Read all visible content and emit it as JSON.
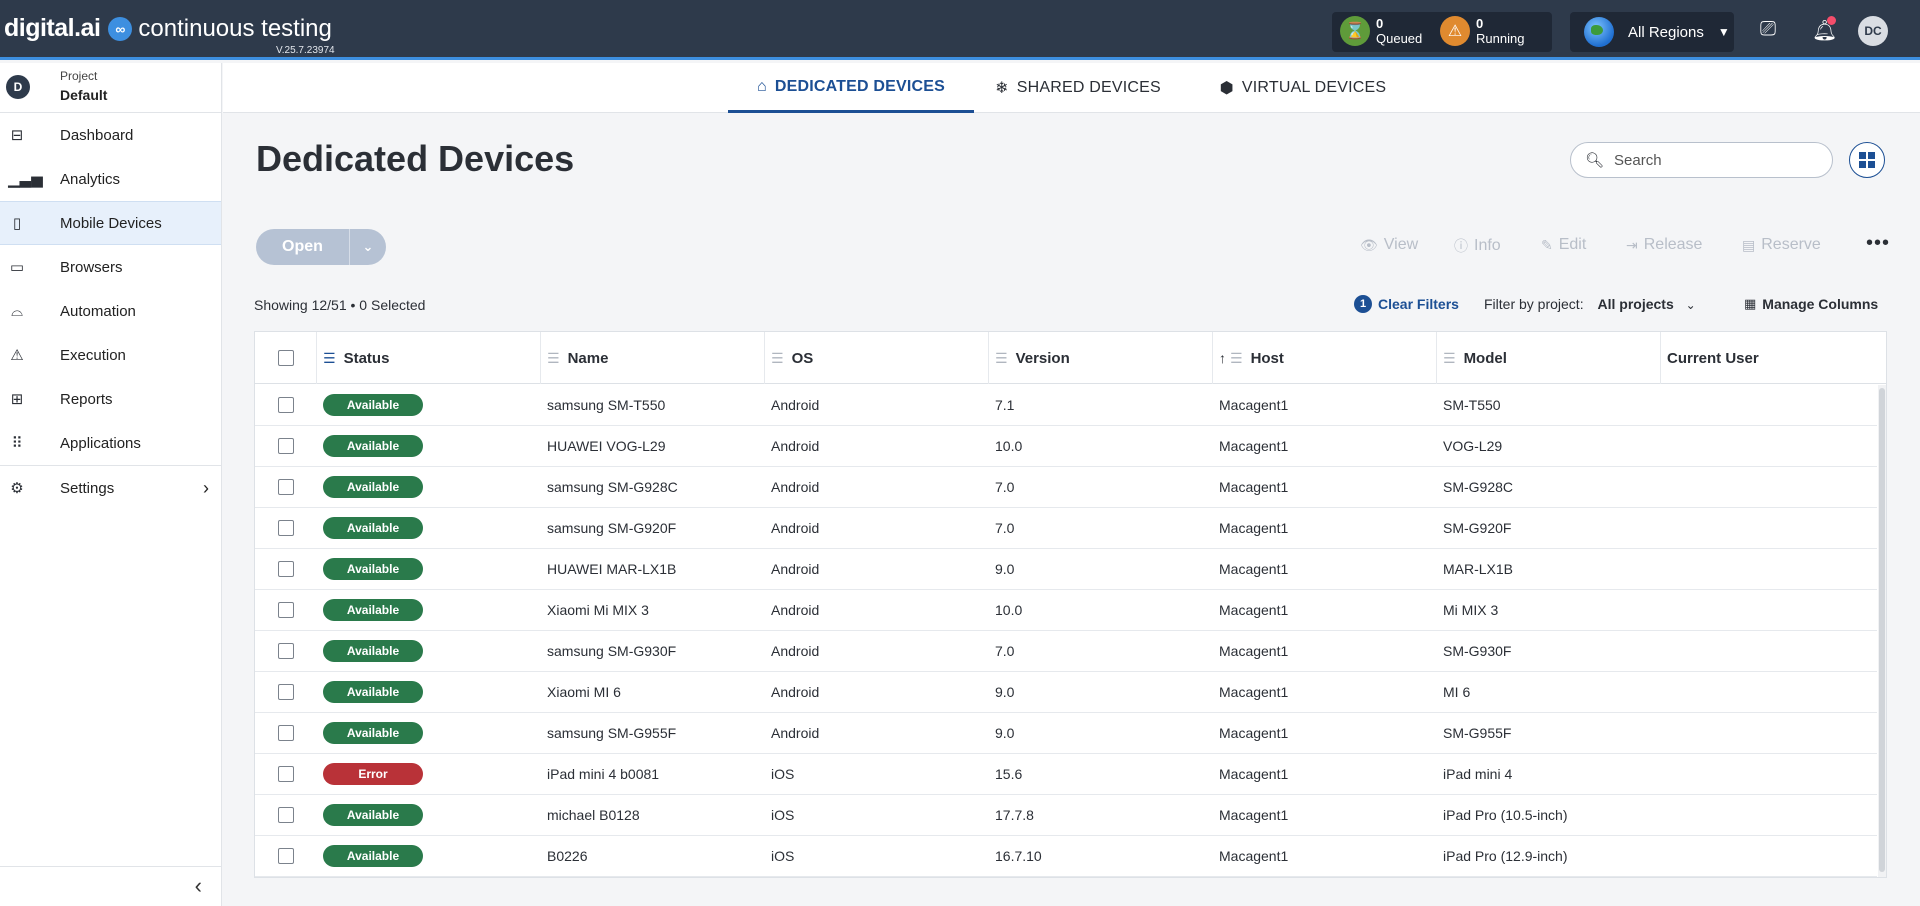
{
  "header": {
    "brand": "digital.ai",
    "product": "continuous testing",
    "version": "V.25.7.23974",
    "queued": {
      "count": "0",
      "label": "Queued",
      "color": "#5f9b3a"
    },
    "running": {
      "count": "0",
      "label": "Running",
      "color": "#e08a2f"
    },
    "region": "All Regions",
    "avatar": "DC"
  },
  "sidebar": {
    "project_badge": "D",
    "project_label": "Project",
    "project_name": "Default",
    "items": [
      {
        "label": "Dashboard",
        "icon": "dashboard-icon"
      },
      {
        "label": "Analytics",
        "icon": "analytics-icon"
      },
      {
        "label": "Mobile Devices",
        "icon": "mobile-devices-icon"
      },
      {
        "label": "Browsers",
        "icon": "browsers-icon"
      },
      {
        "label": "Automation",
        "icon": "automation-icon"
      },
      {
        "label": "Execution",
        "icon": "execution-icon"
      },
      {
        "label": "Reports",
        "icon": "reports-icon"
      },
      {
        "label": "Applications",
        "icon": "applications-icon"
      },
      {
        "label": "Settings",
        "icon": "settings-icon"
      }
    ]
  },
  "tabs": [
    {
      "label": "DEDICATED DEVICES",
      "icon": "home-icon"
    },
    {
      "label": "SHARED DEVICES",
      "icon": "snowflake-icon"
    },
    {
      "label": "VIRTUAL DEVICES",
      "icon": "cube-icon"
    }
  ],
  "page": {
    "title": "Dedicated Devices",
    "search_placeholder": "Search",
    "open_label": "Open",
    "actions": {
      "view": "View",
      "info": "Info",
      "edit": "Edit",
      "release": "Release",
      "reserve": "Reserve"
    },
    "showing": "Showing 12/51 • 0 Selected",
    "clear_filters_count": "1",
    "clear_filters": "Clear Filters",
    "filter_by_project": "Filter by project:",
    "filter_value": "All projects",
    "manage_columns": "Manage Columns"
  },
  "table": {
    "columns": [
      "Status",
      "Name",
      "OS",
      "Version",
      "Host",
      "Model",
      "Current User"
    ],
    "rows": [
      {
        "status": "Available",
        "name": "samsung SM-T550",
        "os": "Android",
        "version": "7.1",
        "host": "Macagent1",
        "model": "SM-T550",
        "user": ""
      },
      {
        "status": "Available",
        "name": "HUAWEI VOG-L29",
        "os": "Android",
        "version": "10.0",
        "host": "Macagent1",
        "model": "VOG-L29",
        "user": ""
      },
      {
        "status": "Available",
        "name": "samsung SM-G928C",
        "os": "Android",
        "version": "7.0",
        "host": "Macagent1",
        "model": "SM-G928C",
        "user": ""
      },
      {
        "status": "Available",
        "name": "samsung SM-G920F",
        "os": "Android",
        "version": "7.0",
        "host": "Macagent1",
        "model": "SM-G920F",
        "user": ""
      },
      {
        "status": "Available",
        "name": "HUAWEI MAR-LX1B",
        "os": "Android",
        "version": "9.0",
        "host": "Macagent1",
        "model": "MAR-LX1B",
        "user": ""
      },
      {
        "status": "Available",
        "name": "Xiaomi Mi MIX 3",
        "os": "Android",
        "version": "10.0",
        "host": "Macagent1",
        "model": "Mi MIX 3",
        "user": ""
      },
      {
        "status": "Available",
        "name": "samsung SM-G930F",
        "os": "Android",
        "version": "7.0",
        "host": "Macagent1",
        "model": "SM-G930F",
        "user": ""
      },
      {
        "status": "Available",
        "name": "Xiaomi MI 6",
        "os": "Android",
        "version": "9.0",
        "host": "Macagent1",
        "model": "MI 6",
        "user": ""
      },
      {
        "status": "Available",
        "name": "samsung SM-G955F",
        "os": "Android",
        "version": "9.0",
        "host": "Macagent1",
        "model": "SM-G955F",
        "user": ""
      },
      {
        "status": "Error",
        "name": "iPad mini 4 b0081",
        "os": "iOS",
        "version": "15.6",
        "host": "Macagent1",
        "model": "iPad mini 4",
        "user": ""
      },
      {
        "status": "Available",
        "name": "michael B0128",
        "os": "iOS",
        "version": "17.7.8",
        "host": "Macagent1",
        "model": "iPad Pro (10.5-inch)",
        "user": ""
      },
      {
        "status": "Available",
        "name": "B0226",
        "os": "iOS",
        "version": "16.7.10",
        "host": "Macagent1",
        "model": "iPad Pro (12.9-inch)",
        "user": ""
      }
    ]
  }
}
